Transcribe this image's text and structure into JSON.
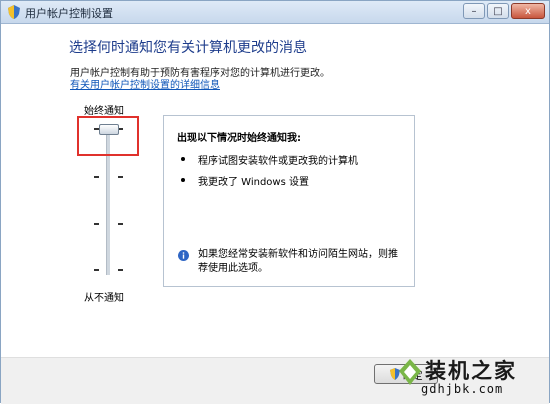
{
  "window": {
    "title": "用户帐户控制设置",
    "controls": {
      "minimize": "–",
      "maximize": "□",
      "close": "x"
    }
  },
  "main": {
    "heading": "选择何时通知您有关计算机更改的消息",
    "description": "用户帐户控制有助于预防有害程序对您的计算机进行更改。",
    "link": "有关用户帐户控制设置的详细信息"
  },
  "slider": {
    "top_label": "始终通知",
    "bottom_label": "从不通知",
    "levels": 4,
    "selected_level": 1
  },
  "panel": {
    "title": "出现以下情况时始终通知我:",
    "bullets": [
      "程序试图安装软件或更改我的计算机",
      "我更改了 Windows 设置"
    ],
    "note": "如果您经常安装新软件和访问陌生网站，则推荐使用此选项。"
  },
  "footer": {
    "ok_label": "确定"
  },
  "watermark": {
    "text": "装机之家",
    "url": "gdhjbk.com"
  },
  "colors": {
    "heading": "#1e3d8c",
    "link": "#0f56b8",
    "highlight": "#e0312c"
  }
}
